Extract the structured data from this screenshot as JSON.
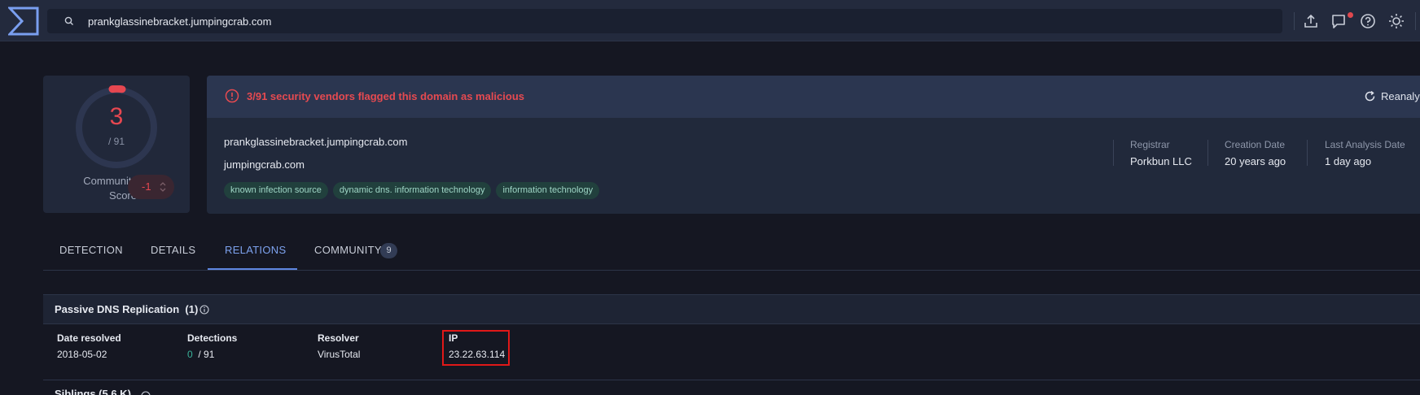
{
  "search": {
    "query": "prankglassinebracket.jumpingcrab.com"
  },
  "score": {
    "detections": "3",
    "total": "/ 91",
    "community_label": "Community Score",
    "community_value": "-1"
  },
  "alert": {
    "text": "3/91 security vendors flagged this domain as malicious",
    "reanalyze_label": "Reanaly"
  },
  "domain": {
    "name": "prankglassinebracket.jumpingcrab.com",
    "parent": "jumpingcrab.com",
    "tags": [
      "known infection source",
      "dynamic dns. information technology",
      "information technology"
    ]
  },
  "meta": {
    "registrar_label": "Registrar",
    "registrar_value": "Porkbun LLC",
    "creation_label": "Creation Date",
    "creation_value": "20 years ago",
    "analysis_label": "Last Analysis Date",
    "analysis_value": "1 day ago"
  },
  "tabs": {
    "detection": "DETECTION",
    "details": "DETAILS",
    "relations": "RELATIONS",
    "community": "COMMUNITY",
    "community_count": "9"
  },
  "relations": {
    "title": "Passive DNS Replication",
    "count": "(1)",
    "columns": {
      "date": "Date resolved",
      "detections": "Detections",
      "resolver": "Resolver",
      "ip": "IP"
    },
    "row": {
      "date": "2018-05-02",
      "detections_zero": "0",
      "detections_total": "/ 91",
      "resolver": "VirusTotal",
      "ip": "23.22.63.114"
    },
    "next_section": "Siblings (5.6 K)"
  },
  "colors": {
    "malicious": "#e64750",
    "accent": "#5e86e0",
    "clean": "#39b39a",
    "highlight": "#e01818"
  }
}
